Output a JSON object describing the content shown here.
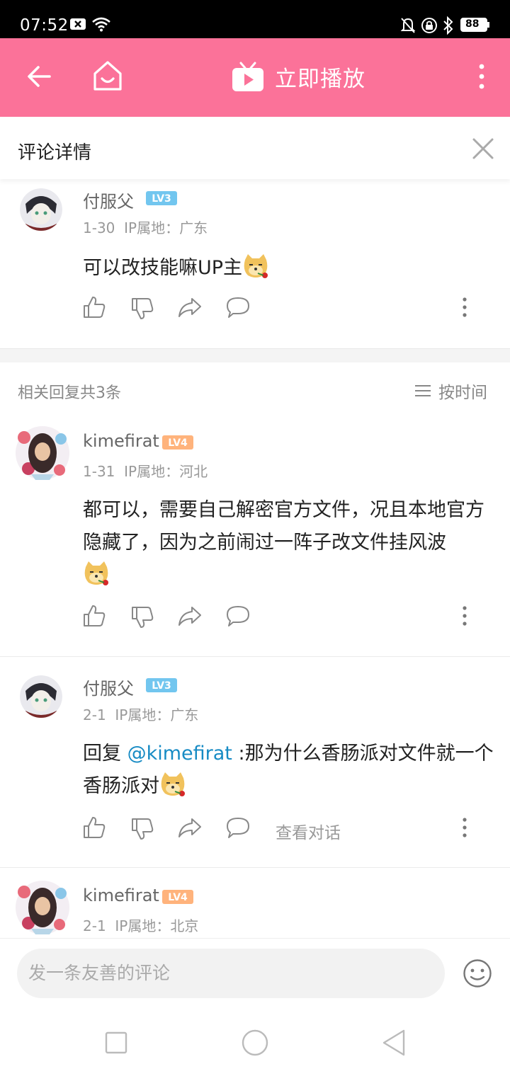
{
  "status_bar": {
    "time": "07:52",
    "battery": "88",
    "icons": [
      "notification-x-icon",
      "wifi-icon",
      "silent-bell-icon",
      "rotation-lock-icon",
      "bluetooth-icon",
      "battery-icon"
    ]
  },
  "topbar": {
    "title": "立即播放",
    "accent_color": "#FB7299",
    "icons": [
      "back-arrow-icon",
      "home-icon",
      "tv-play-icon",
      "more-vertical-icon"
    ]
  },
  "detail": {
    "title": "评论详情"
  },
  "main_comment": {
    "username": "付服父",
    "level": "LV3",
    "date": "1-30",
    "ip": "IP属地：广东",
    "content": "可以改技能嘛UP主"
  },
  "replies_header": {
    "count_label": "相关回复共3条",
    "sort_label": "按时间"
  },
  "replies": [
    {
      "username": "kimefirat",
      "level": "LV4",
      "date": "1-31",
      "ip": "IP属地：河北",
      "content": "都可以，需要自己解密官方文件，况且本地官方隐藏了，因为之前闹过一阵子改文件挂风波"
    },
    {
      "username": "付服父",
      "level": "LV3",
      "date": "2-1",
      "ip": "IP属地：广东",
      "reply_prefix": "回复 ",
      "mention": "@kimefirat",
      "content": " :那为什么香肠派对文件就一个香肠派对",
      "view_conversation": "查看对话"
    },
    {
      "username": "kimefirat",
      "level": "LV4",
      "date": "2-1",
      "ip": "IP属地：北京"
    }
  ],
  "composer": {
    "placeholder": "发一条友善的评论"
  },
  "colors": {
    "lv3": "#72C6EF",
    "lv4": "#FFB37C",
    "link": "#178BC4"
  }
}
